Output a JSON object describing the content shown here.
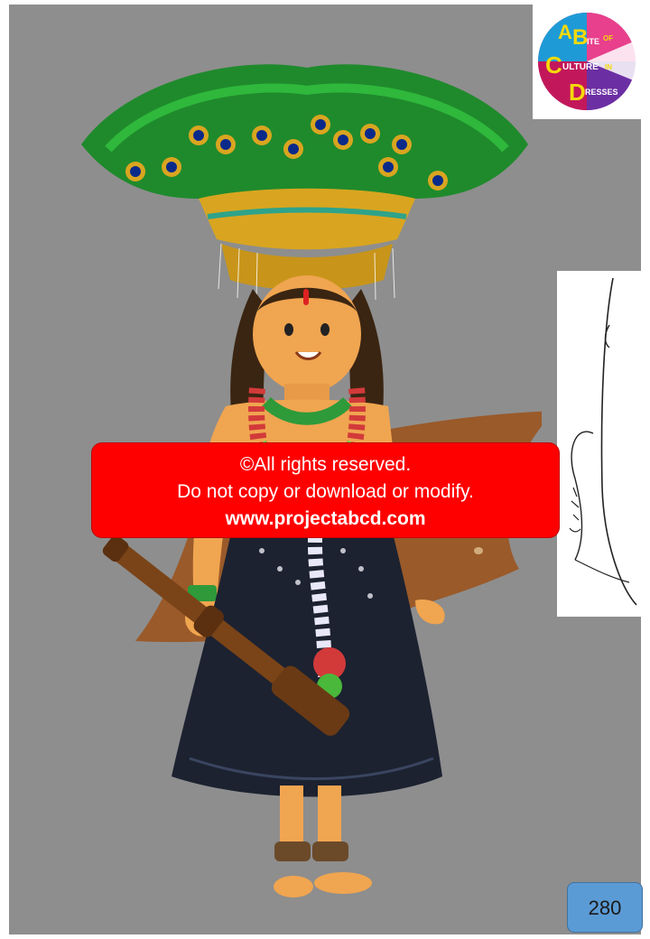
{
  "logo": {
    "letters": [
      "A",
      "B",
      "ITE",
      "OF",
      "C",
      "ULTURE",
      "IN",
      "D",
      "RESSES"
    ],
    "icon": "abcd-logo-icon"
  },
  "illustration": {
    "icon": "peacock-feather-costume-figure-illustration"
  },
  "signature": {
    "icon": "handwritten-signature-icon"
  },
  "banner": {
    "line1": "©All rights reserved.",
    "line2": "Do not copy or download or modify.",
    "url": "www.projectabcd.com"
  },
  "page": {
    "number": "280"
  },
  "colors": {
    "background": "#8e8e8e",
    "banner": "#ff0000",
    "page_badge": "#5b9bd5",
    "feathers": "#1f8a2c",
    "skirt": "#1c2230"
  }
}
